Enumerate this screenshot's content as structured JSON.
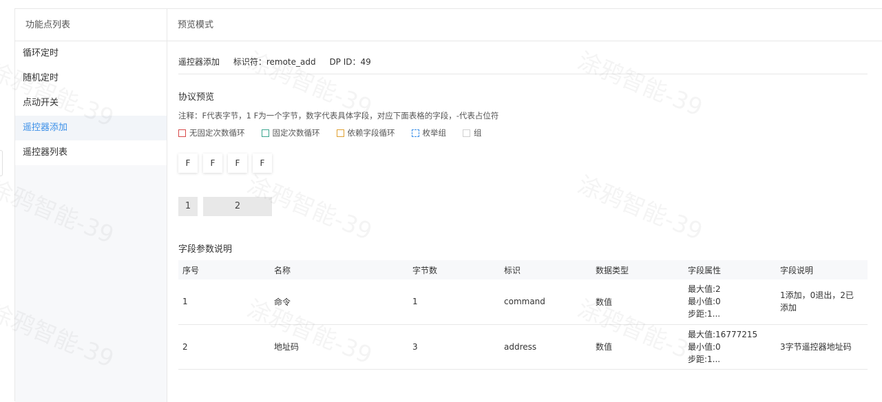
{
  "sidebar": {
    "header": "功能点列表",
    "items": [
      {
        "label": "循环定时",
        "active": false
      },
      {
        "label": "随机定时",
        "active": false
      },
      {
        "label": "点动开关",
        "active": false
      },
      {
        "label": "遥控器添加",
        "active": true
      },
      {
        "label": "遥控器列表",
        "active": false
      }
    ]
  },
  "main": {
    "header": "预览模式",
    "info": {
      "name": "遥控器添加",
      "identifier": "标识符：remote_add",
      "dp_id": "DP ID：49"
    },
    "protocol": {
      "title": "协议预览",
      "note": "注释：F代表字节，1 F为一个字节，数字代表具体字段，对应下面表格的字段，-代表占位符",
      "legend": [
        {
          "label": "无固定次数循环",
          "color": "#d84a4a"
        },
        {
          "label": "固定次数循环",
          "color": "#3aa58e"
        },
        {
          "label": "依赖字段循环",
          "color": "#e0a030"
        },
        {
          "label": "枚举组",
          "color": "#3b8fe8"
        },
        {
          "label": "组",
          "color": "#cfcfcf"
        }
      ],
      "bytes": [
        "F",
        "F",
        "F",
        "F"
      ],
      "fields": [
        "1",
        "2"
      ]
    },
    "field_section": {
      "title": "字段参数说明",
      "columns": [
        "序号",
        "名称",
        "字节数",
        "标识",
        "数据类型",
        "字段属性",
        "字段说明"
      ],
      "rows": [
        {
          "index": "1",
          "name": "命令",
          "bytes": "1",
          "identifier": "command",
          "type": "数值",
          "attrs": [
            "最大值:2",
            "最小值:0",
            "步距:1..."
          ],
          "description": "1添加，0退出，2已添加"
        },
        {
          "index": "2",
          "name": "地址码",
          "bytes": "3",
          "identifier": "address",
          "type": "数值",
          "attrs": [
            "最大值:16777215",
            "最小值:0",
            "步距:1..."
          ],
          "description": "3字节遥控器地址码"
        }
      ]
    }
  },
  "watermark": "涂鸦智能-39"
}
